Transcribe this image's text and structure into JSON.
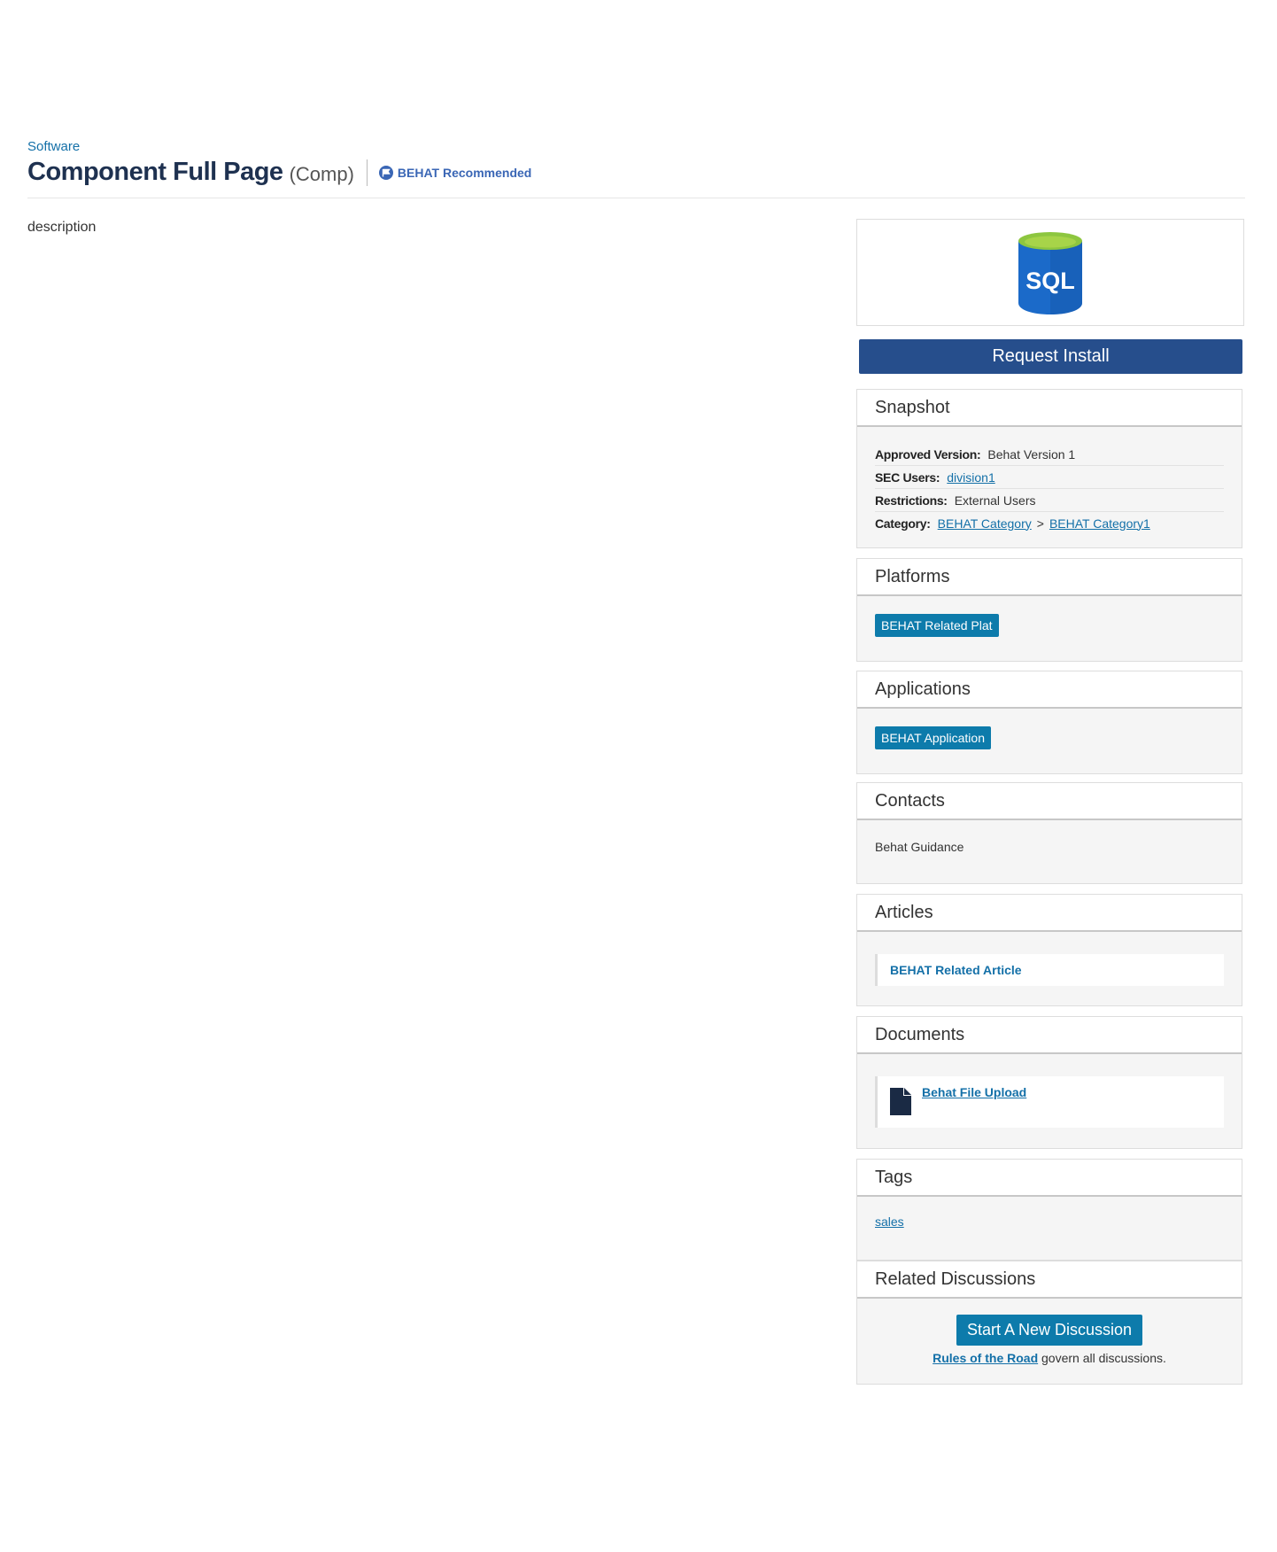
{
  "breadcrumb": "Software",
  "header": {
    "title": "Component Full Page",
    "type": "(Comp)",
    "badge": "BEHAT Recommended"
  },
  "description": "description",
  "logo": {
    "text": "SQL",
    "icon": "sql-database-icon"
  },
  "request_install": "Request Install",
  "snapshot": {
    "title": "Snapshot",
    "approved_version_label": "Approved Version:",
    "approved_version": "Behat Version 1",
    "sec_users_label": "SEC Users:",
    "sec_users": "division1",
    "restrictions_label": "Restrictions:",
    "restrictions": "External Users",
    "category_label": "Category:",
    "category": "BEHAT Category",
    "category_sep": ">",
    "subcategory": "BEHAT Category1"
  },
  "platforms": {
    "title": "Platforms",
    "items": [
      "BEHAT Related Plat"
    ]
  },
  "applications": {
    "title": "Applications",
    "items": [
      "BEHAT Application"
    ]
  },
  "contacts": {
    "title": "Contacts",
    "items": [
      "Behat Guidance"
    ]
  },
  "articles": {
    "title": "Articles",
    "items": [
      "BEHAT Related Article"
    ]
  },
  "documents": {
    "title": "Documents",
    "items": [
      "Behat File Upload"
    ]
  },
  "tags": {
    "title": "Tags",
    "items": [
      "sales"
    ]
  },
  "discussions": {
    "title": "Related Discussions",
    "button": "Start A New Discussion",
    "rules_link": "Rules of the Road",
    "rules_text": "govern all discussions."
  },
  "colors": {
    "primary": "#264e8c",
    "accent": "#0d7bab",
    "link": "#1470a8",
    "title": "#1e3150"
  }
}
